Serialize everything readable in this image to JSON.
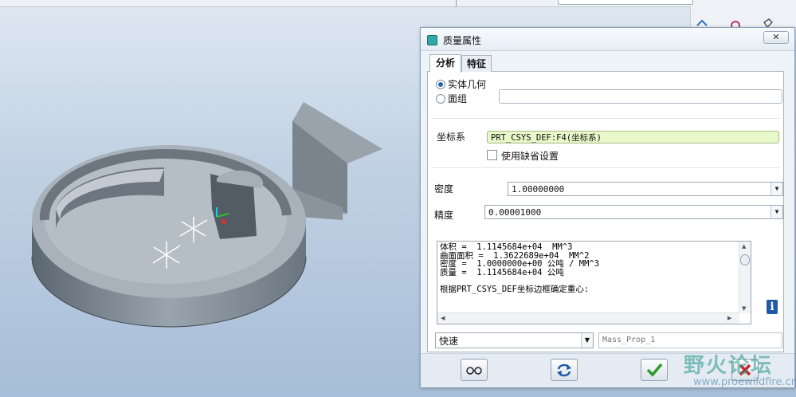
{
  "dialog": {
    "title": "质量属性",
    "close_label": "✕",
    "tabs": [
      {
        "label": "分析",
        "active": true
      },
      {
        "label": "特征",
        "active": false
      }
    ],
    "geometry_options": [
      {
        "label": "实体几何",
        "selected": true
      },
      {
        "label": "面组",
        "selected": false
      }
    ],
    "csys": {
      "label": "坐标系",
      "value": "PRT_CSYS_DEF:F4(坐标系)",
      "use_default_label": "使用缺省设置",
      "use_default_checked": false
    },
    "density": {
      "label": "密度",
      "value": "1.00000000"
    },
    "accuracy": {
      "label": "精度",
      "value": "0.00001000"
    },
    "results": {
      "lines": [
        "体积 =  1.1145684e+04  MM^3",
        "曲面面积 =  1.3622689e+04  MM^2",
        "密度 =  1.0000000e+00 公吨 / MM^3",
        "质量 =  1.1145684e+04 公吨",
        "",
        "根据PRT_CSYS_DEF坐标边框确定重心:"
      ]
    },
    "mode": {
      "value": "快速"
    },
    "feature_name": {
      "placeholder": "Mass_Prop_1"
    },
    "buttons": {
      "preview": "glasses-icon",
      "repeat": "refresh-icon",
      "ok": "checkmark-icon",
      "cancel": "x-icon"
    }
  },
  "watermark": {
    "text": "野火论坛",
    "url": "www.proewildfire.cn"
  },
  "colors": {
    "accent": "#2a66b0",
    "csys_field": "#e9f8c8",
    "ok_green": "#2e9b2e",
    "cancel_red": "#c8282a"
  }
}
